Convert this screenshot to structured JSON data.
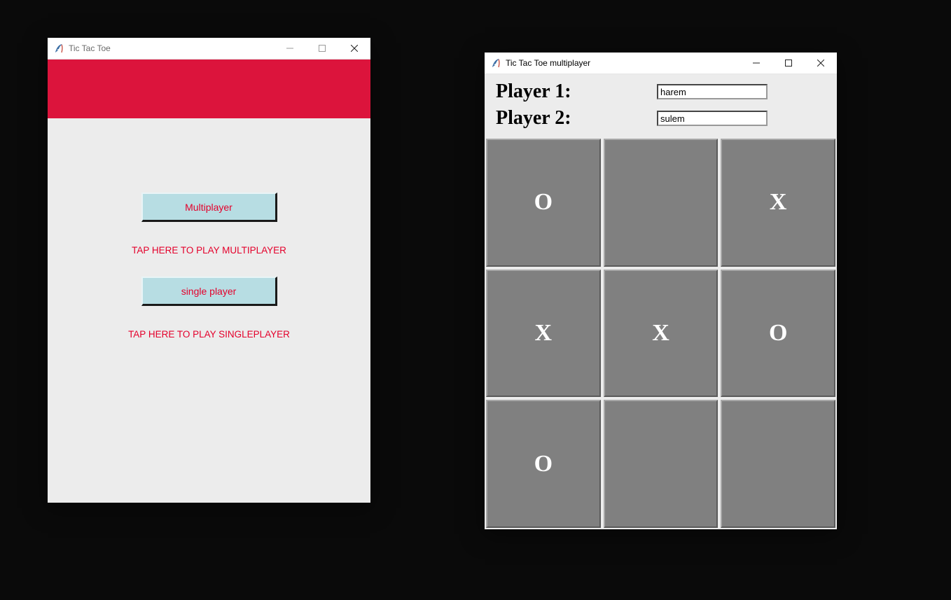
{
  "window1": {
    "title": "Tic Tac Toe",
    "buttons": {
      "multiplayer": "Multiplayer",
      "singleplayer": "single player"
    },
    "captions": {
      "multiplayer": "TAP HERE TO PLAY MULTIPLAYER",
      "singleplayer": "TAP HERE TO PLAY SINGLEPLAYER"
    }
  },
  "window2": {
    "title": "Tic Tac Toe multiplayer",
    "player1_label": "Player 1:",
    "player2_label": "Player 2:",
    "player1_value": "harem",
    "player2_value": "sulem",
    "board": [
      [
        "O",
        "",
        "X"
      ],
      [
        "X",
        "X",
        "O"
      ],
      [
        "O",
        "",
        ""
      ]
    ]
  }
}
